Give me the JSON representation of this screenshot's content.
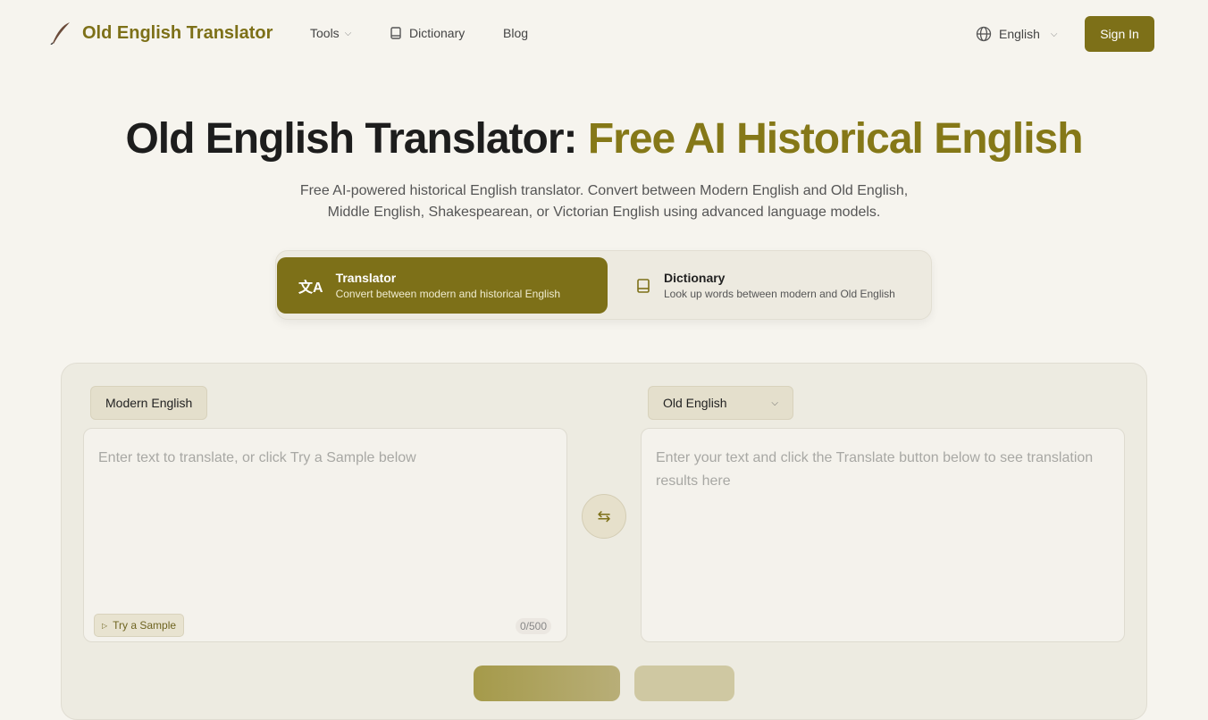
{
  "header": {
    "brand": "Old English Translator",
    "nav": {
      "tools": "Tools",
      "dictionary": "Dictionary",
      "blog": "Blog"
    },
    "language": "English",
    "sign_in": "Sign In"
  },
  "hero": {
    "title_main": "Old English Translator: ",
    "title_accent": "Free AI Historical English",
    "subtitle_line1": "Free AI-powered historical English translator. Convert between Modern English and Old English,",
    "subtitle_line2": "Middle English, Shakespearean, or Victorian English using advanced language models."
  },
  "modes": [
    {
      "title": "Translator",
      "desc": "Convert between modern and historical English"
    },
    {
      "title": "Dictionary",
      "desc": "Look up words between modern and Old English"
    }
  ],
  "translator": {
    "source_lang": "Modern English",
    "target_lang": "Old English",
    "input_placeholder": "Enter text to translate, or click Try a Sample below",
    "output_placeholder": "Enter your text and click the Translate button below to see translation results here",
    "try_sample": "Try a Sample",
    "char_count": "0/500"
  },
  "colors": {
    "accent": "#7d7018",
    "background": "#f6f4ee"
  }
}
